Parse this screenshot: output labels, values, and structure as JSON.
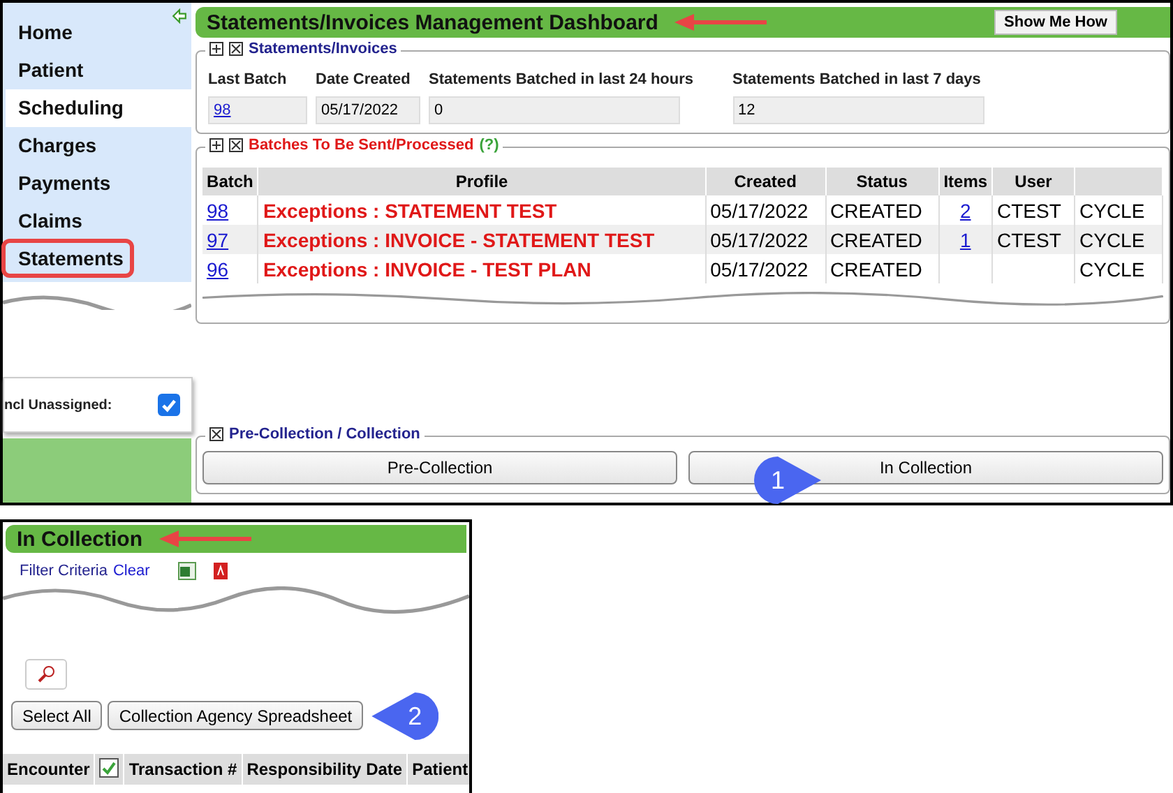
{
  "dashboard": {
    "sidebar": {
      "items": [
        {
          "label": "Home",
          "selected": false,
          "highlighted": false
        },
        {
          "label": "Patient",
          "selected": false,
          "highlighted": false
        },
        {
          "label": "Scheduling",
          "selected": true,
          "highlighted": false
        },
        {
          "label": "Charges",
          "selected": false,
          "highlighted": false
        },
        {
          "label": "Payments",
          "selected": false,
          "highlighted": false
        },
        {
          "label": "Claims",
          "selected": false,
          "highlighted": false
        },
        {
          "label": "Statements",
          "selected": false,
          "highlighted": true
        }
      ],
      "option": {
        "label": "ncl Unassigned:",
        "checked": true
      }
    },
    "title": "Statements/Invoices Management Dashboard",
    "help_button": "Show Me How",
    "summary": {
      "legend": "Statements/Invoices",
      "fields": [
        {
          "label": "Last Batch",
          "value": "98",
          "kind": "link"
        },
        {
          "label": "Date Created",
          "value": "05/17/2022",
          "kind": "text"
        },
        {
          "label": "Statements Batched in last 24 hours",
          "value": "0",
          "kind": "text"
        },
        {
          "label": "Statements Batched in last 7 days",
          "value": "12",
          "kind": "text"
        }
      ]
    },
    "batches": {
      "legend": "Batches To Be Sent/Processed",
      "help": "(?)",
      "columns": [
        "Batch",
        "Profile",
        "Created",
        "Status",
        "Items",
        "User"
      ],
      "rows": [
        {
          "batch": "98",
          "profile": "Exceptions : STATEMENT TEST",
          "created": "05/17/2022",
          "status": "CREATED",
          "items": "2",
          "user": "CTEST",
          "column_7": "CYCLE"
        },
        {
          "batch": "97",
          "profile": "Exceptions : INVOICE - STATEMENT TEST",
          "created": "05/17/2022",
          "status": "CREATED",
          "items": "1",
          "user": "CTEST",
          "column_7": "CYCLE"
        },
        {
          "batch": "96",
          "profile": "Exceptions : INVOICE - TEST PLAN",
          "created": "05/17/2022",
          "status": "CREATED",
          "column_7": "CYCLE"
        }
      ]
    },
    "collection": {
      "legend": "Pre-Collection / Collection",
      "buttons": [
        "Pre-Collection",
        "In Collection"
      ]
    },
    "callout": "1"
  },
  "in_collection": {
    "title": "In Collection",
    "filter_label": "Filter Criteria",
    "clear_link": "Clear",
    "buttons": [
      "Select All",
      "Collection Agency Spreadsheet"
    ],
    "callout": "2",
    "columns": [
      "Encounter",
      "Transaction #",
      "Responsibility Date",
      "Patient"
    ],
    "select_all_checked": true
  }
}
